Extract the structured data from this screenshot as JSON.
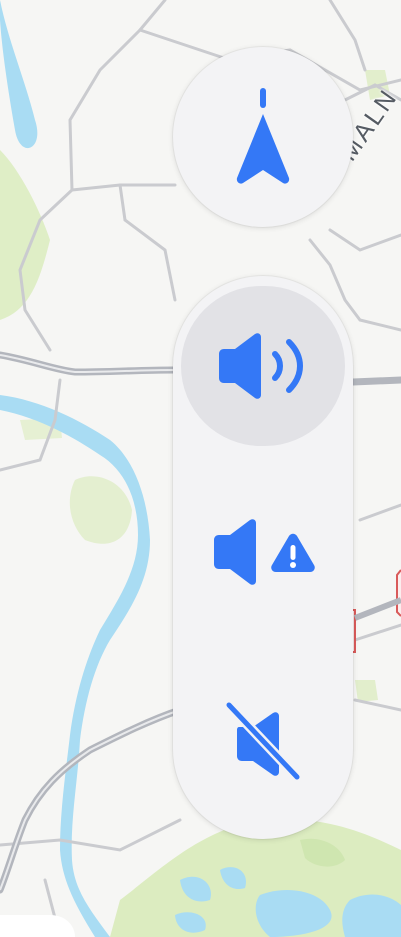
{
  "map": {
    "road_label": "MALN",
    "colors": {
      "background": "#f6f6f4",
      "water": "#a9dcf3",
      "park": "#dfeec6",
      "road": "#c7c8cc",
      "highway": "#b3b6bd"
    }
  },
  "compass": {
    "icon": "navigation-arrow-icon",
    "accent": "#3478f6"
  },
  "audio_options": [
    {
      "icon": "speaker-sound-on-icon",
      "selected": true
    },
    {
      "icon": "speaker-alerts-only-icon",
      "selected": false
    },
    {
      "icon": "speaker-muted-icon",
      "selected": false
    }
  ],
  "accent_color": "#3478f6"
}
